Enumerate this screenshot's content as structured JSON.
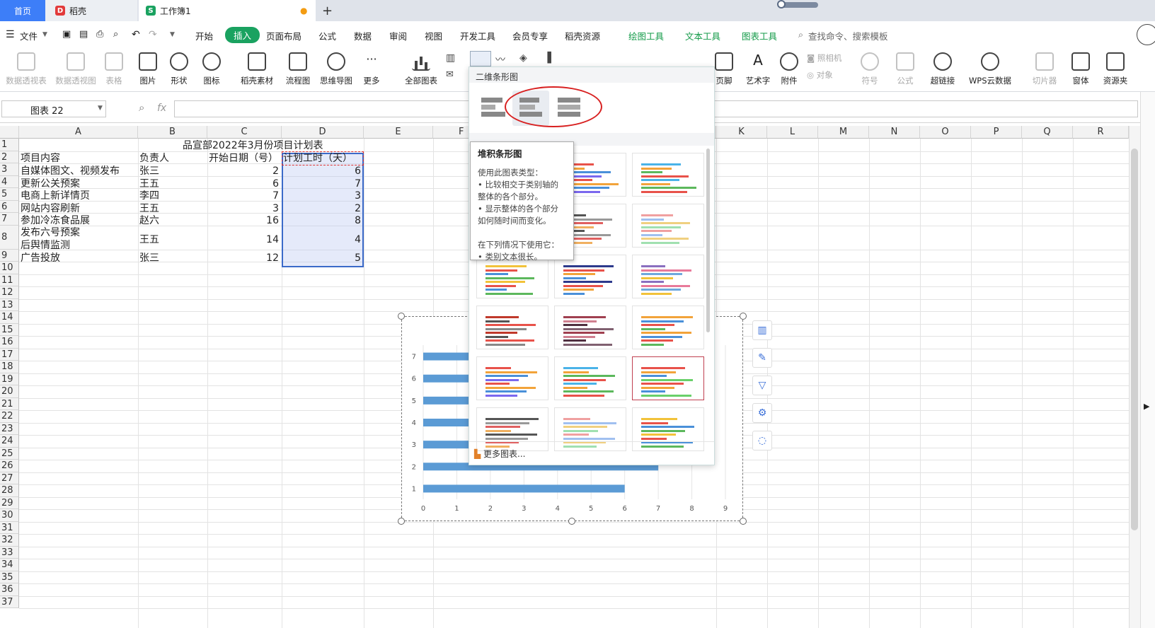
{
  "tabs": {
    "home": "首页",
    "daoke": "稻壳",
    "workbook": "工作簿1",
    "add": "+"
  },
  "menu": {
    "file": "文件",
    "items": [
      "开始",
      "插入",
      "页面布局",
      "公式",
      "数据",
      "审阅",
      "视图",
      "开发工具",
      "会员专享",
      "稻壳资源"
    ],
    "tools": [
      "绘图工具",
      "文本工具",
      "图表工具"
    ],
    "search": "查找命令、搜索模板"
  },
  "ribbon": {
    "left": [
      "数据透视表",
      "数据透视图",
      "表格",
      "图片",
      "形状",
      "图标",
      "稻壳素材",
      "流程图",
      "思维导图",
      "更多",
      "全部图表"
    ],
    "right": [
      "页脚",
      "艺术字",
      "附件",
      "照相机",
      "对象",
      "符号",
      "公式",
      "超链接",
      "WPS云数据",
      "切片器",
      "窗体",
      "资源夹"
    ]
  },
  "formula_bar": {
    "name_box": "图表 22",
    "fx": "fx"
  },
  "columns": [
    "A",
    "B",
    "C",
    "D",
    "E",
    "F",
    "K",
    "L",
    "M",
    "N",
    "O",
    "P",
    "Q",
    "R"
  ],
  "rows": [
    "1",
    "2",
    "3",
    "4",
    "5",
    "6",
    "7",
    "8",
    "9",
    "10",
    "11",
    "12",
    "13",
    "14",
    "15",
    "16",
    "17",
    "18",
    "19",
    "20",
    "21",
    "22",
    "23",
    "24",
    "25",
    "26",
    "27",
    "28",
    "29",
    "30",
    "31",
    "32",
    "33",
    "34",
    "35",
    "36",
    "37"
  ],
  "sheet": {
    "title": "品宣部2022年3月份项目计划表",
    "headers": [
      "项目内容",
      "负责人",
      "开始日期（号）",
      "计划工时（天）"
    ],
    "data": [
      [
        "自媒体图文、视频发布",
        "张三",
        "2",
        "6"
      ],
      [
        "更新公关预案",
        "王五",
        "6",
        "7"
      ],
      [
        "电商上新详情页",
        "李四",
        "7",
        "3"
      ],
      [
        "网站内容刷新",
        "王五",
        "3",
        "2"
      ],
      [
        "参加冷冻食品展",
        "赵六",
        "16",
        "8"
      ],
      [
        "发布六号预案",
        "王五",
        "14",
        "4"
      ],
      [
        "广告投放",
        "张三",
        "12",
        "5"
      ]
    ],
    "row8_extra": "后舆情监测"
  },
  "chart_data": {
    "type": "bar",
    "orientation": "horizontal",
    "categories": [
      "1",
      "2",
      "3",
      "4",
      "5",
      "6",
      "7"
    ],
    "values": [
      6,
      7,
      3,
      2,
      8,
      4,
      5
    ],
    "xlim": [
      0,
      9
    ],
    "x_ticks": [
      "0",
      "1",
      "2",
      "3",
      "4",
      "5",
      "6",
      "7",
      "8",
      "9"
    ],
    "color": "#5b9bd5"
  },
  "dropdown": {
    "title": "二维条形图",
    "more": "更多图表..."
  },
  "tooltip": {
    "title": "堆积条形图",
    "lines": [
      "使用此图表类型：",
      "• 比较相交于类别轴的",
      "整体的各个部分。",
      "• 显示整体的各个部分",
      "如何随时间而变化。",
      "",
      "在下列情况下使用它：",
      "• 类别文本很长。"
    ]
  },
  "colors": {
    "accent": "#1aa260",
    "tab_blue": "#3d7ef8",
    "highlight_red": "#d82020"
  }
}
